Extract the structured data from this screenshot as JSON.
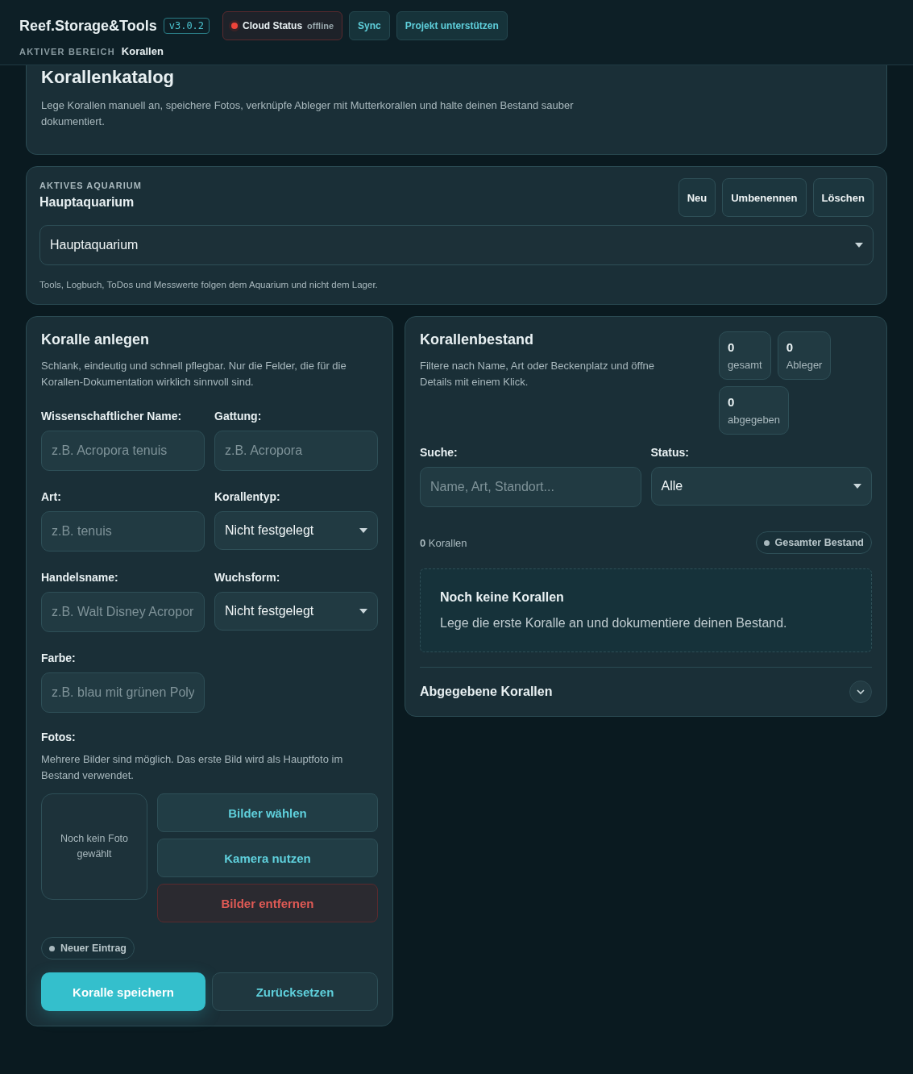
{
  "header": {
    "brand": "Reef.Storage&Tools",
    "version": "v3.0.2",
    "cloud": {
      "label": "Cloud Status",
      "status": "offline",
      "online": false
    },
    "buttons": [
      "Sync",
      "Projekt unterstützen"
    ],
    "area_label": "AKTIVER BEREICH",
    "area": "Korallen"
  },
  "catalog": {
    "title": "Korallenkatalog",
    "description": "Lege Korallen manuell an, speichere Fotos, verknüpfe Ableger mit Mutterkorallen und halte deinen Bestand sauber dokumentiert."
  },
  "aquarium": {
    "label": "AKTIVES AQUARIUM",
    "name": "Hauptaquarium",
    "buttons": [
      "Neu",
      "Umbenennen",
      "Löschen"
    ],
    "select": "Hauptaquarium",
    "note": "Tools, Logbuch, ToDos und Messwerte folgen dem Aquarium und nicht dem Lager."
  },
  "form": {
    "title": "Koralle anlegen",
    "description": "Schlank, eindeutig und schnell pflegbar. Nur die Felder, die für die Korallen-Dokumentation wirklich sinnvoll sind.",
    "fields": [
      {
        "label": "Wissenschaftlicher Name:",
        "kind": "input",
        "placeholder": "z.B. Acropora tenuis"
      },
      {
        "label": "Gattung:",
        "kind": "input",
        "placeholder": "z.B. Acropora"
      },
      {
        "label": "Art:",
        "kind": "input",
        "placeholder": "z.B. tenuis"
      },
      {
        "label": "Korallentyp:",
        "kind": "select",
        "value": "Nicht festgelegt"
      },
      {
        "label": "Handelsname:",
        "kind": "input",
        "placeholder": "z.B. Walt Disney Acropor"
      },
      {
        "label": "Wuchsform:",
        "kind": "select",
        "value": "Nicht festgelegt"
      },
      {
        "label": "Farbe:",
        "kind": "input",
        "placeholder": "z.B. blau mit grünen Poly"
      }
    ],
    "photos_label": "Fotos:",
    "photos_hint": "Mehrere Bilder sind möglich. Das erste Bild wird als Hauptfoto im Bestand verwendet.",
    "photo_empty": "Noch kein Foto gewählt",
    "photo_buttons": [
      {
        "label": "Bilder wählen",
        "kind": "normal"
      },
      {
        "label": "Kamera nutzen",
        "kind": "normal"
      },
      {
        "label": "Bilder entfernen",
        "kind": "danger"
      }
    ],
    "status_chip": "Neuer Eintrag",
    "save": "Koralle speichern",
    "reset": "Zurücksetzen"
  },
  "inventory": {
    "title": "Korallenbestand",
    "description": "Filtere nach Name, Art oder Beckenplatz und öffne Details mit einem Klick.",
    "stats": [
      {
        "value": "0",
        "label": "gesamt"
      },
      {
        "value": "0",
        "label": "Ableger"
      },
      {
        "value": "0",
        "label": "abgegeben"
      }
    ],
    "search_label": "Suche:",
    "search_placeholder": "Name, Art, Standort...",
    "status_label": "Status:",
    "status_value": "Alle",
    "count_number": "0",
    "count_label": "Korallen",
    "scope_chip": "Gesamter Bestand",
    "empty_title": "Noch keine Korallen",
    "empty_text": "Lege die erste Koralle an und dokumentiere deinen Bestand.",
    "given_away": {
      "title": "Abgegebene Korallen",
      "expanded": false
    }
  }
}
